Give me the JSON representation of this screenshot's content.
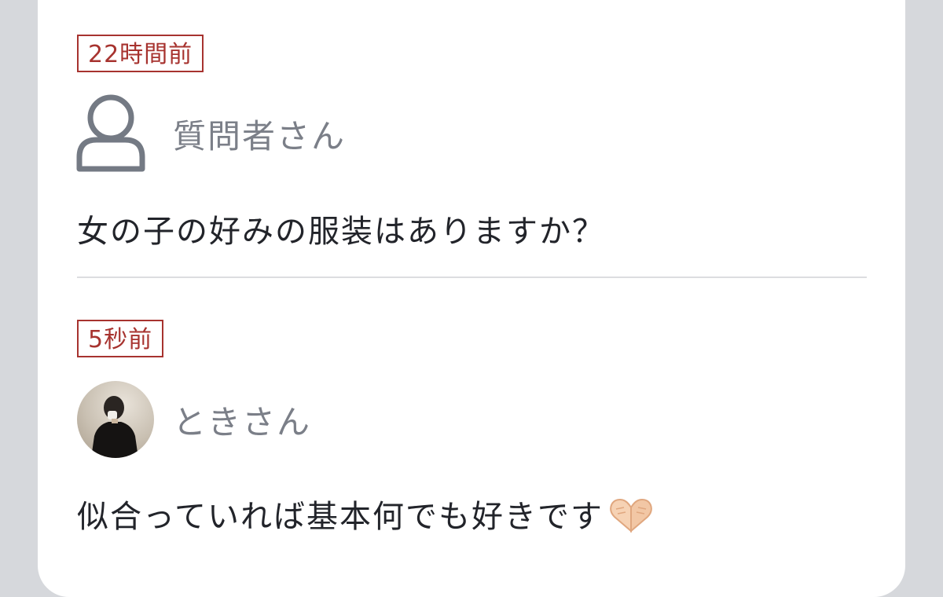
{
  "question": {
    "time_badge": "22時間前",
    "user_name": "質問者さん",
    "avatar_icon": "user-outline-icon",
    "text": "女の子の好みの服装はありますか？"
  },
  "answer": {
    "time_badge": "5秒前",
    "user_name": "ときさん",
    "avatar_icon": "profile-photo",
    "text": "似合っていれば基本何でも好きです",
    "emoji": "heart-hands-icon"
  },
  "colors": {
    "badge": "#a7332f",
    "username": "#7b7f88",
    "text": "#22242a",
    "background": "#d6d8dc",
    "card": "#ffffff"
  }
}
